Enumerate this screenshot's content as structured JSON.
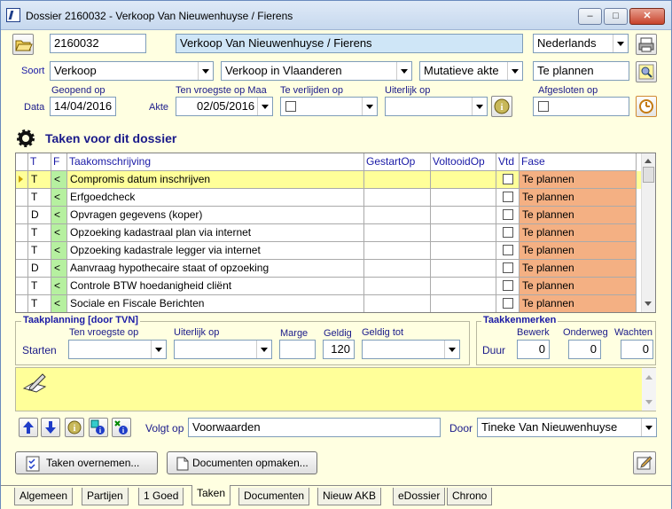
{
  "window": {
    "title": "Dossier 2160032 - Verkoop Van Nieuwenhuyse / Fierens",
    "min_label": "–",
    "max_label": "□",
    "close_label": "✕"
  },
  "header": {
    "dossier_number": "2160032",
    "dossier_name": "Verkoop Van Nieuwenhuyse / Fierens",
    "language": "Nederlands"
  },
  "soort": {
    "label": "Soort",
    "type": "Verkoop",
    "subtype": "Verkoop in Vlaanderen",
    "akte_type": "Mutatieve akte",
    "status": "Te plannen"
  },
  "data": {
    "label": "Data",
    "akte_label": "Akte",
    "geopend_label": "Geopend op",
    "geopend_value": "14/04/2016",
    "vroegste_label": "Ten vroegste op Maa",
    "vroegste_value": "02/05/2016",
    "verlijden_label": "Te verlijden op",
    "uiterlijk_label": "Uiterlijk op",
    "afgesloten_label": "Afgesloten op"
  },
  "tasks": {
    "title": "Taken voor dit dossier",
    "columns": [
      "T",
      "F",
      "Taakomschrijving",
      "GestartOp",
      "VoltooidOp",
      "Vtd",
      "Fase"
    ],
    "rows": [
      {
        "t": "T",
        "f": "<",
        "desc": "Compromis datum inschrijven",
        "fase": "Te plannen"
      },
      {
        "t": "T",
        "f": "<",
        "desc": "Erfgoedcheck",
        "fase": "Te plannen"
      },
      {
        "t": "D",
        "f": "<",
        "desc": "Opvragen gegevens (koper)",
        "fase": "Te plannen"
      },
      {
        "t": "T",
        "f": "<",
        "desc": "Opzoeking kadastraal plan via internet",
        "fase": "Te plannen"
      },
      {
        "t": "T",
        "f": "<",
        "desc": "Opzoeking kadastrale legger via internet",
        "fase": "Te plannen"
      },
      {
        "t": "D",
        "f": "<",
        "desc": "Aanvraag hypothecaire staat of opzoeking",
        "fase": "Te plannen"
      },
      {
        "t": "T",
        "f": "<",
        "desc": "Controle BTW hoedanigheid cliënt",
        "fase": "Te plannen"
      },
      {
        "t": "T",
        "f": "<",
        "desc": "Sociale en Fiscale Berichten",
        "fase": "Te plannen"
      }
    ]
  },
  "planning": {
    "title": "Taakplanning  [door TVN]",
    "starten_label": "Starten",
    "vroegste_label": "Ten vroegste op",
    "uiterlijk_label": "Uiterlijk op",
    "marge_label": "Marge",
    "geldig_label": "Geldig",
    "geldig_value": "120",
    "geldig_tot_label": "Geldig tot"
  },
  "kenmerken": {
    "title": "Taakkenmerken",
    "duur_label": "Duur",
    "bewerk_label": "Bewerk",
    "bewerk_value": "0",
    "onderweg_label": "Onderweg",
    "onderweg_value": "0",
    "wachten_label": "Wachten",
    "wachten_value": "0"
  },
  "footer": {
    "volgt_label": "Volgt op",
    "volgt_value": "Voorwaarden",
    "door_label": "Door",
    "door_value": "Tineke Van Nieuwenhuyse",
    "taken_btn": "Taken overnemen...",
    "docs_btn": "Documenten opmaken..."
  },
  "tabs": [
    "Algemeen",
    "Partijen",
    "1 Goed",
    "Taken",
    "Documenten",
    "Nieuw AKB",
    "eDossier",
    "Chrono"
  ],
  "colors": {
    "background": "#ffffe1",
    "selected_row": "#ffff99",
    "fase_cell": "#f4b083",
    "f_cell": "#b6f0a0",
    "name_field": "#cfe6f7"
  }
}
